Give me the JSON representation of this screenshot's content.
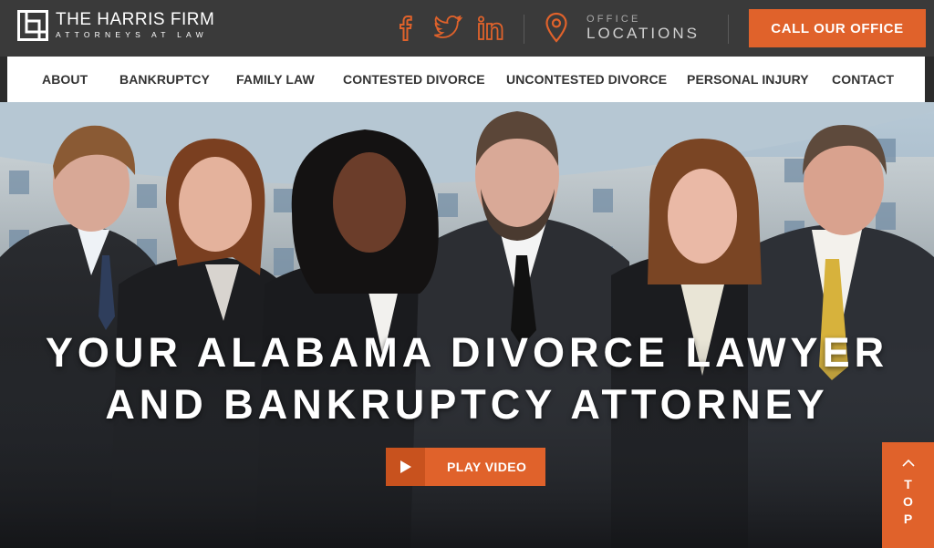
{
  "brand": {
    "name": "THE HARRIS FIRM",
    "tagline": "ATTORNEYS AT LAW"
  },
  "social": [
    {
      "name": "facebook-icon"
    },
    {
      "name": "twitter-icon"
    },
    {
      "name": "linkedin-icon"
    }
  ],
  "office": {
    "small": "OFFICE",
    "big": "LOCATIONS"
  },
  "call_label": "CALL OUR OFFICE",
  "nav": [
    "ABOUT",
    "BANKRUPTCY",
    "FAMILY LAW",
    "CONTESTED DIVORCE",
    "UNCONTESTED DIVORCE",
    "PERSONAL INJURY",
    "CONTACT"
  ],
  "hero": {
    "line1": "YOUR ALABAMA DIVORCE LAWYER",
    "line2": "AND BANKRUPTCY ATTORNEY",
    "play_label": "PLAY VIDEO"
  },
  "top": {
    "letters": [
      "T",
      "O",
      "P"
    ]
  },
  "colors": {
    "accent": "#e0622b",
    "topbar": "#3a3a3a"
  }
}
